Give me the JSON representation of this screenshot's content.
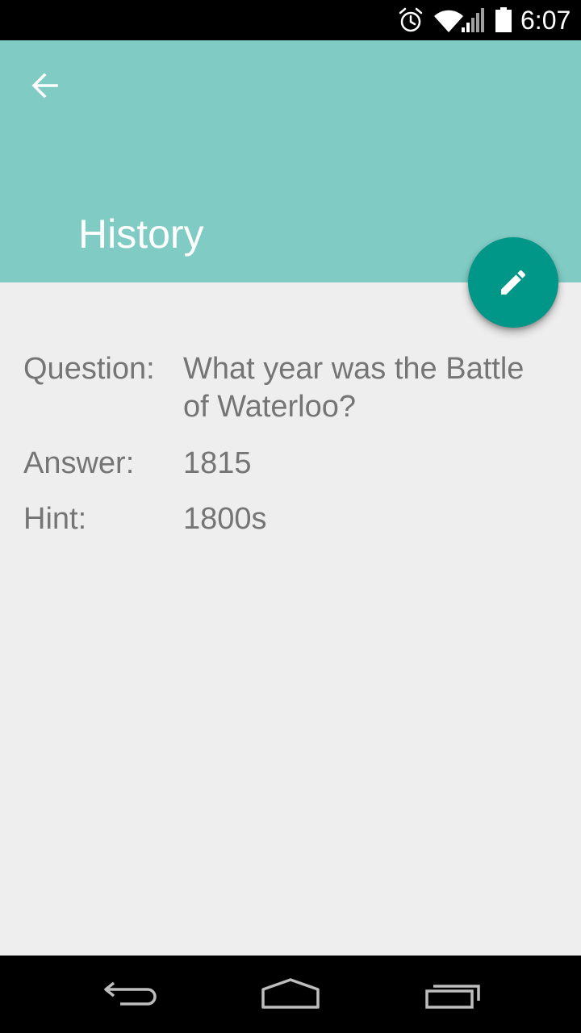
{
  "status_bar": {
    "time": "6:07",
    "icons": [
      "alarm-icon",
      "wifi-icon",
      "signal-icon",
      "battery-icon"
    ]
  },
  "app_bar": {
    "title": "History",
    "back_icon": "arrow-back-icon",
    "color": "#80cbc4"
  },
  "fab": {
    "icon": "pencil-icon",
    "color": "#009688"
  },
  "card": {
    "question_label": "Question:",
    "question_value": "What year was the Battle of Waterloo?",
    "answer_label": "Answer:",
    "answer_value": "1815",
    "hint_label": "Hint:",
    "hint_value": "1800s"
  },
  "nav_bar": {
    "icons": [
      "nav-back-icon",
      "nav-home-icon",
      "nav-recents-icon"
    ]
  }
}
